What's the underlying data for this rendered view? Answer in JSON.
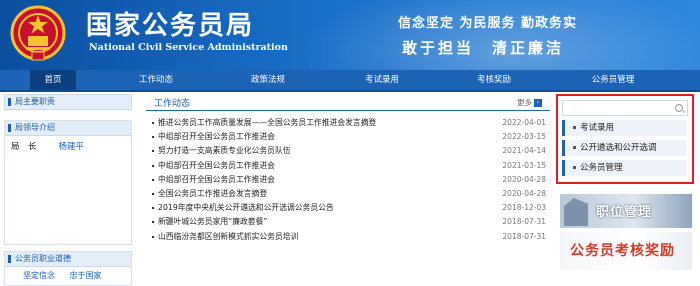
{
  "header": {
    "title": "国家公务员局",
    "subtitle": "National Civil Service Administration",
    "slogan_line1": "信念坚定 为民服务 勤政务实",
    "slogan_line2": "敢于担当　清正廉洁",
    "emblem_icon": "national-emblem-icon",
    "colors": {
      "header_blue": "#1a6fc8",
      "nav_blue": "#1d63b5",
      "highlight_red": "#e02020"
    }
  },
  "nav": {
    "items": [
      {
        "label": "首页",
        "active": true
      },
      {
        "label": "工作动态"
      },
      {
        "label": "政策法规"
      },
      {
        "label": "考试录用"
      },
      {
        "label": "考核奖励"
      },
      {
        "label": "公务员管理"
      }
    ]
  },
  "left": {
    "section1": "局主要职责",
    "section2": "局领导介绍",
    "leader_role": "局　长",
    "leader_name": "杨建平",
    "section3": "公务员职业道德",
    "bottom_link1": "坚定信念",
    "bottom_link2": "忠于国家"
  },
  "main": {
    "title": "工作动态",
    "more_label": "更多",
    "news": [
      {
        "title": "推进公务员工作高质量发展——全国公务员工作推进会发言摘登",
        "date": "2022-04-01"
      },
      {
        "title": "中组部召开全国公务员工作推进会",
        "date": "2022-03-15"
      },
      {
        "title": "努力打造一支高素质专业化公务员队伍",
        "date": "2021-04-14"
      },
      {
        "title": "中组部召开全国公务员工作推进会",
        "date": "2021-03-15"
      },
      {
        "title": "中组部召开全国公务员工作推进会",
        "date": "2020-04-28"
      },
      {
        "title": "全国公务员工作推进会发言摘登",
        "date": "2020-04-28"
      },
      {
        "title": "2019年度中央机关公开遴选和公开选调公务员公告",
        "date": "2018-12-03"
      },
      {
        "title": "新疆叶城公务员家用“廉政套餐”",
        "date": "2018-07-31"
      },
      {
        "title": "山西临汾尧都区创新模式抓实公务员培训",
        "date": "2018-07-31"
      }
    ]
  },
  "right": {
    "search_placeholder": "",
    "menu": [
      {
        "label": "考试录用"
      },
      {
        "label": "公开遴选和公开选调"
      },
      {
        "label": "公务员管理"
      }
    ],
    "banner1": "职位管理",
    "banner2": "公务员考核奖励"
  }
}
